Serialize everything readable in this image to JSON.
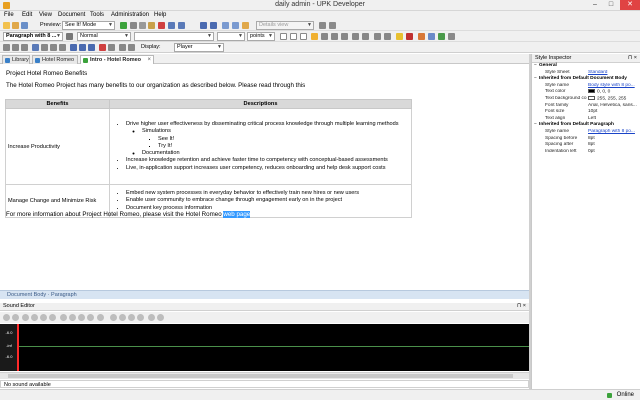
{
  "window": {
    "title": "daily admin - UPK Developer"
  },
  "menu": [
    "File",
    "Edit",
    "View",
    "Document",
    "Tools",
    "Administration",
    "Help"
  ],
  "toolbar": {
    "preview_label": "Preview:",
    "preview_mode": "See It! Mode",
    "view_placeholder": "Details view",
    "paragraph_style": "Paragraph with 8 ...",
    "font_style": "Normal",
    "font_size_unit": "points",
    "display_label": "Display:",
    "display_value": "Player"
  },
  "tabs": [
    {
      "label": "Library",
      "active": false
    },
    {
      "label": "Hotel Romeo",
      "active": false
    },
    {
      "label": "Intro - Hotel Romeo",
      "active": true
    }
  ],
  "document": {
    "title": "Project Hotel Romeo Benefits",
    "intro": "The Hotel Romeo Project has many benefits to our organization as described below. Please read through this",
    "table": {
      "headers": [
        "Benefits",
        "Descriptions"
      ],
      "row1": {
        "benefit": "Increase Productivity",
        "b1": "Drive higher user effectiveness by disseminating critical process knowledge through multiple learning methods",
        "sim": "Simulations",
        "see": "See It!",
        "try": "Try It!",
        "docs": "Documentation",
        "b2": "Increase knowledge retention and achieve faster time to competency with conceptual-based assessments",
        "b3": "Live, in-application support increases user competency, reduces onboarding and help desk support costs"
      },
      "row2": {
        "benefit": "Manage Change and Minimize Risk",
        "b1": "Embed new system processes in everyday behavior to effectively train new hires or new users",
        "b2": "Enable user community to embrace change through engagement early on in the project",
        "b3": "Document key process information"
      }
    },
    "more_text": "For more information about Project Hotel Romeo, please visit the Hotel Romeo",
    "more_link": "web page"
  },
  "doc_status": {
    "body": "Document Body",
    "sep": " · ",
    "para": "Paragraph"
  },
  "sound": {
    "title": "Sound Editor",
    "status": "No sound available",
    "gains": [
      "-6.0",
      "-inf",
      "-6.0"
    ]
  },
  "inspector": {
    "title": "Style Inspector",
    "groups": [
      {
        "name": "General",
        "rows": [
          {
            "k": "Style Sheet",
            "v": "Standard",
            "link": true
          }
        ]
      },
      {
        "name": "Inherited from Default Document Body",
        "rows": [
          {
            "k": "Style name",
            "v": "Body style with 8 po...",
            "link": true
          },
          {
            "k": "Text color",
            "v": "0, 0, 0",
            "swatch": "#000000"
          },
          {
            "k": "Text background co",
            "v": "255, 255, 255",
            "swatch": "#ffffff"
          },
          {
            "k": "Font family",
            "v": "Arial, Helvetica, sans..."
          },
          {
            "k": "Font size",
            "v": "10pt"
          },
          {
            "k": "Text align",
            "v": "Left"
          }
        ]
      },
      {
        "name": "Inherited from Default Paragraph",
        "rows": [
          {
            "k": "Style name",
            "v": "Paragraph with 8 po...",
            "link": true
          },
          {
            "k": "Spacing before",
            "v": "8pt"
          },
          {
            "k": "Spacing after",
            "v": "8pt"
          },
          {
            "k": "Indentation left",
            "v": "0pt"
          }
        ]
      }
    ]
  },
  "status": {
    "online": "Online"
  },
  "colors": {
    "selection": "#3399ff",
    "close": "#e04343",
    "waveform_bg": "#000000",
    "playhead": "#ff2a2a"
  }
}
